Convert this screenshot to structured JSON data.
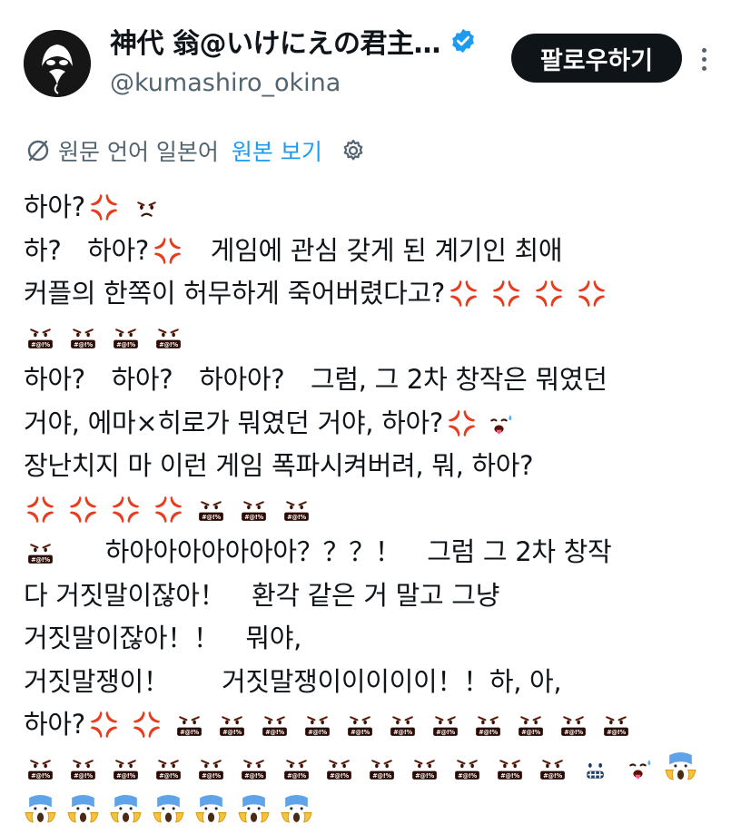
{
  "author": {
    "display_name": "神代 翁@いけにえの君主…",
    "handle": "@kumashiro_okina",
    "verified": true
  },
  "follow_button": {
    "label": "팔로우하기"
  },
  "translation": {
    "info": "원문 언어 일본어",
    "show_original": "원본 보기"
  },
  "tweet": {
    "lines": [
      "하아?",
      "하?　하아?",
      "　게임에 관심 갖게 된 계기인 최애",
      "커플의 한쪽이 허무하게 죽어버렸다고?",
      "하아?　하아?　하아아?　그럼, 그 2차 창작은 뭐였던",
      "거야, 에마×히로가 뭐였던 거야, 하아?",
      "장난치지 마 이런 게임 폭파시켜버려, 뭐, 하아?",
      "　하아아아아아아아？？？！　그럼 그 2차 창작",
      "다 거짓말이잖아！　환각 같은 거 말고 그냥",
      "거짓말이잖아！！　뭐야,",
      "거짓말쟁이！　　거짓말쟁이이이이이！！하, 아,",
      "하아?"
    ]
  },
  "colors": {
    "text": "#0f1419",
    "secondary": "#536471",
    "link": "#1d9bf0",
    "button_bg": "#0f1419"
  },
  "icons": {
    "anger": "anger-symbol-icon",
    "pouting": "pouting-face-icon",
    "cursing": "face-with-symbols-on-mouth-icon",
    "hot": "hot-face-icon",
    "cold": "cold-face-icon",
    "scream": "face-screaming-in-fear-icon",
    "cursing_text": "#@!%"
  }
}
